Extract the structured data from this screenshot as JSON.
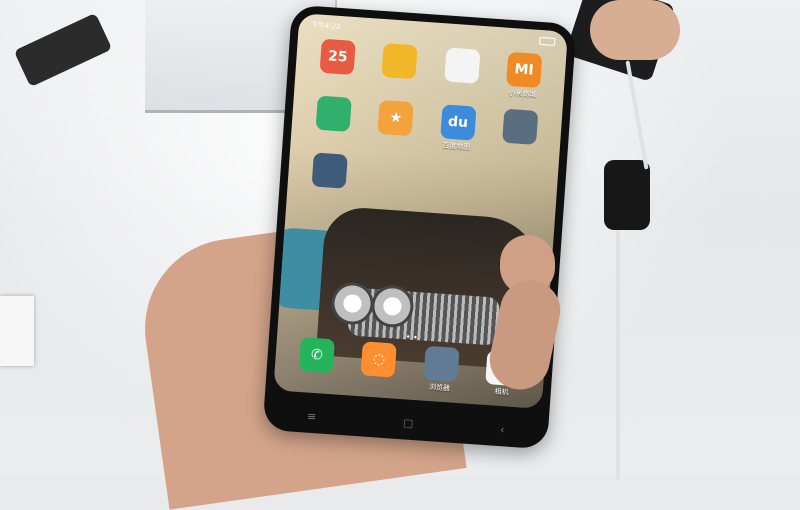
{
  "scene": {
    "description_tag": "photo"
  },
  "phone": {
    "status_time": "下午4:22",
    "home_apps": [
      {
        "name": "calendar",
        "label": "",
        "glyph": "25",
        "color": "#e85a41"
      },
      {
        "name": "notes",
        "label": "",
        "glyph": "",
        "color": "#f2b629"
      },
      {
        "name": "app-store",
        "label": "",
        "glyph": "",
        "color": "#f4f4f4"
      },
      {
        "name": "mi-store",
        "label": "小米商城",
        "glyph": "MI",
        "color": "#f08a24"
      },
      {
        "name": "mi-home",
        "label": "",
        "glyph": "",
        "color": "#2fb06c"
      },
      {
        "name": "star-app",
        "label": "",
        "glyph": "★",
        "color": "#f3a23c"
      },
      {
        "name": "baidu-maps",
        "label": "百度地图",
        "glyph": "du",
        "color": "#3c8bdc"
      },
      {
        "name": "folder",
        "label": "",
        "glyph": "",
        "color": "#5a6e82"
      },
      {
        "name": "folder-2",
        "label": "",
        "glyph": "",
        "color": "#3e5c7a"
      }
    ],
    "dock_apps": [
      {
        "name": "phone",
        "label": "",
        "glyph": "✆",
        "color": "#25b45c"
      },
      {
        "name": "messages",
        "label": "",
        "glyph": "◌",
        "color": "#ff8f2e"
      },
      {
        "name": "browser",
        "label": "浏览器",
        "glyph": "",
        "color": "#607b93"
      },
      {
        "name": "camera",
        "label": "相机",
        "glyph": "",
        "color": "#f5f5f5"
      }
    ],
    "nav": [
      "≡",
      "▢",
      "‹"
    ]
  }
}
